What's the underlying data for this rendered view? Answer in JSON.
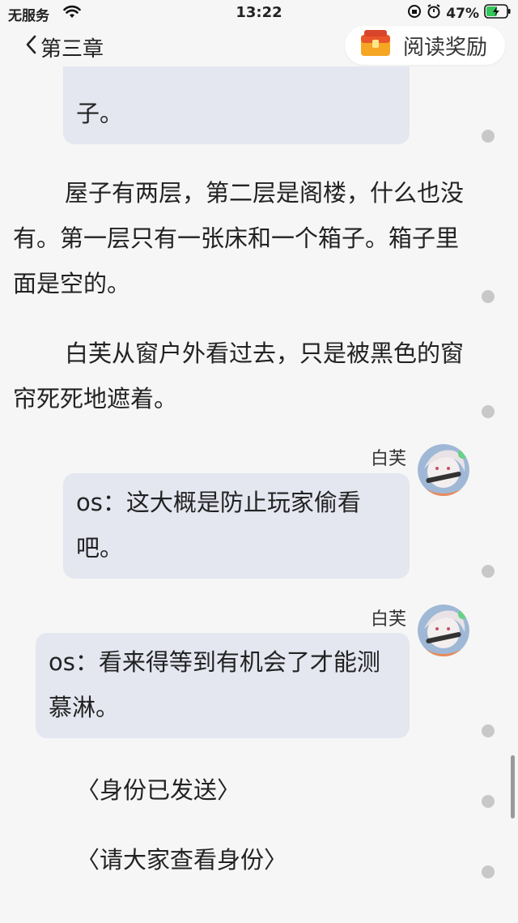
{
  "status_bar": {
    "carrier": "无服务",
    "time": "13:22",
    "battery": "47%"
  },
  "nav": {
    "back_label": "第三章",
    "reward_label": "阅读奖励"
  },
  "messages": {
    "first_bubble_tail": "子。",
    "para1": "屋子有两层，第二层是阁楼，什么也没有。第一层只有一张床和一个箱子。箱子里面是空的。",
    "para2": "白芙从窗户外看过去，只是被黑色的窗帘死死地遮着。",
    "msg1": {
      "speaker": "白芙",
      "text": "os：这大概是防止玩家偷看吧。"
    },
    "msg2": {
      "speaker": "白芙",
      "text": "os：看来得等到有机会了才能测慕淋。"
    },
    "sys1": "〈身份已发送〉",
    "sys2": "〈请大家查看身份〉"
  },
  "colors": {
    "bubble": "#e4e6f0",
    "background": "#f6f6f6",
    "dot": "#c8c8c8"
  },
  "icons": [
    "wifi-icon",
    "lock-rotation-icon",
    "alarm-icon",
    "battery-icon",
    "chevron-left-icon",
    "treasure-chest-icon"
  ]
}
